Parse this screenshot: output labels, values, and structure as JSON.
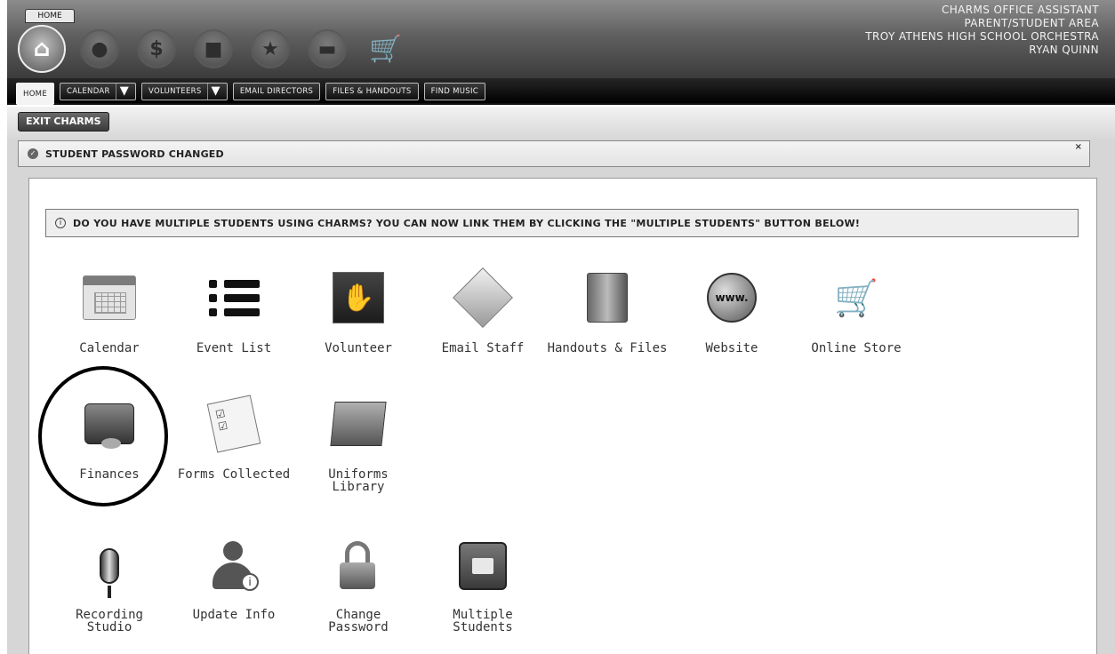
{
  "header": {
    "home_tab": "HOME",
    "info_lines": [
      "CHARMS OFFICE ASSISTANT",
      "PARENT/STUDENT AREA",
      "TROY ATHENS HIGH SCHOOL ORCHESTRA",
      "RYAN QUINN"
    ],
    "top_icons": [
      "home-icon",
      "person-icon",
      "dollar-icon",
      "briefcase-icon",
      "star-icon",
      "chat-icon",
      "cart-icon"
    ]
  },
  "nav": {
    "home": "HOME",
    "calendar": "CALENDAR",
    "volunteers": "VOLUNTEERS",
    "email_directors": "EMAIL DIRECTORS",
    "files_handouts": "FILES & HANDOUTS",
    "find_music": "FIND MUSIC"
  },
  "subbar": {
    "exit": "EXIT CHARMS"
  },
  "notice": {
    "text": "STUDENT PASSWORD CHANGED",
    "close": "×"
  },
  "info": {
    "text": "DO YOU HAVE MULTIPLE STUDENTS USING CHARMS? YOU CAN NOW LINK THEM BY CLICKING THE \"MULTIPLE STUDENTS\" BUTTON BELOW!"
  },
  "tiles": {
    "calendar": "Calendar",
    "event_list": "Event List",
    "volunteer": "Volunteer",
    "email_staff": "Email Staff",
    "handouts_files": "Handouts & Files",
    "website": "Website",
    "website_glyph": "www.",
    "online_store": "Online Store",
    "finances": "Finances",
    "forms_collected": "Forms Collected",
    "uniforms_1": "Uniforms",
    "uniforms_2": "Library",
    "recording_1": "Recording",
    "recording_2": "Studio",
    "update_info": "Update Info",
    "change_1": "Change",
    "change_2": "Password",
    "multiple_1": "Multiple",
    "multiple_2": "Students"
  }
}
